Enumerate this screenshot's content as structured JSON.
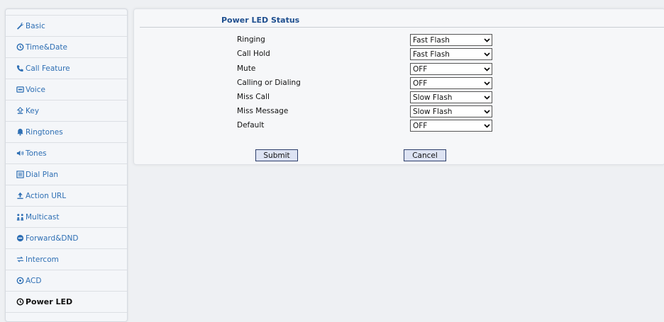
{
  "sidebar": {
    "items": [
      {
        "label": "Basic",
        "icon": "wrench-icon"
      },
      {
        "label": "Time&Date",
        "icon": "clock-icon"
      },
      {
        "label": "Call Feature",
        "icon": "phone-icon"
      },
      {
        "label": "Voice",
        "icon": "voice-icon"
      },
      {
        "label": "Key",
        "icon": "key-icon"
      },
      {
        "label": "Ringtones",
        "icon": "bell-icon"
      },
      {
        "label": "Tones",
        "icon": "speaker-icon"
      },
      {
        "label": "Dial Plan",
        "icon": "list-icon"
      },
      {
        "label": "Action URL",
        "icon": "upload-icon"
      },
      {
        "label": "Multicast",
        "icon": "group-icon"
      },
      {
        "label": "Forward&DND",
        "icon": "minus-circle-icon"
      },
      {
        "label": "Intercom",
        "icon": "arrows-icon"
      },
      {
        "label": "ACD",
        "icon": "acd-icon"
      },
      {
        "label": "Power LED",
        "icon": "clock-icon"
      }
    ],
    "active": "Power LED"
  },
  "main": {
    "title": "Power LED Status",
    "rows": [
      {
        "label": "Ringing",
        "value": "Fast Flash"
      },
      {
        "label": "Call Hold",
        "value": "Fast Flash"
      },
      {
        "label": "Mute",
        "value": "OFF"
      },
      {
        "label": "Calling or Dialing",
        "value": "OFF"
      },
      {
        "label": "Miss Call",
        "value": "Slow Flash"
      },
      {
        "label": "Miss Message",
        "value": "Slow Flash"
      },
      {
        "label": "Default",
        "value": "OFF"
      }
    ],
    "submit_label": "Submit",
    "cancel_label": "Cancel"
  },
  "colors": {
    "link": "#2e6fb4",
    "title": "#1f4f8f",
    "button_bg": "#dde3f3"
  }
}
